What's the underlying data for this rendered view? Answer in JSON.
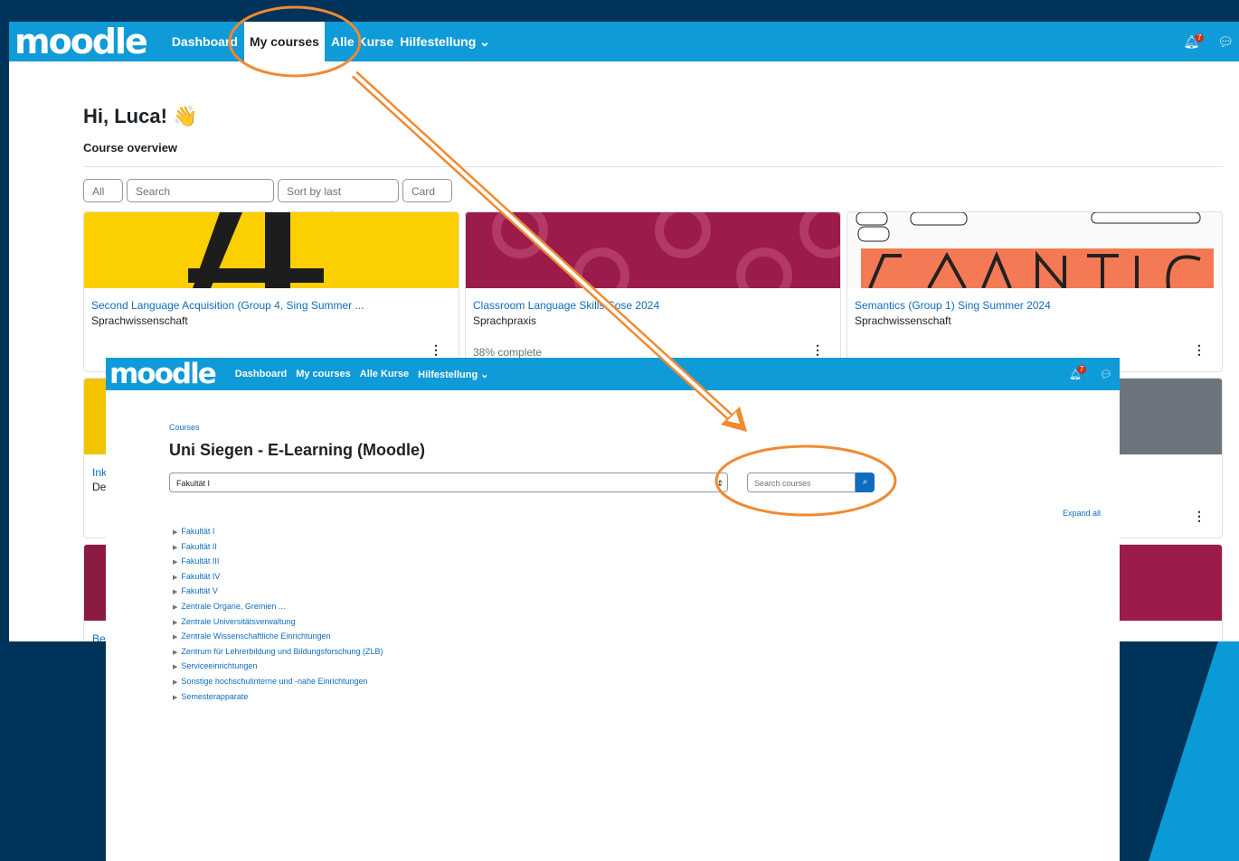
{
  "colors": {
    "background": "#003359",
    "navbar": "#0f9ad8",
    "annotation": "#f08a30",
    "link": "#0f6cbf"
  },
  "top": {
    "nav": {
      "logo": "moodle",
      "links": [
        "Dashboard",
        "My courses",
        "Alle Kurse",
        "Hilfestellung ⌄"
      ],
      "active": "My courses",
      "notification_count": "7"
    },
    "greeting": "Hi, Luca! 👋",
    "section_title": "Course overview",
    "controls": {
      "filter": "All ⌄",
      "search_placeholder": "Search",
      "sort": "Sort by last accessed ⌄",
      "view": "Card ⌄"
    },
    "cards": [
      {
        "title": "Second Language Acquisition (Group 4, Sing Summer ...",
        "category": "Sprachwissenschaft",
        "progress": ""
      },
      {
        "title": "Classroom Language Skills Sose 2024",
        "category": "Sprachpraxis",
        "progress": "38% complete"
      },
      {
        "title": "Semantics (Group 1) Sing Summer 2024",
        "category": "Sprachwissenschaft",
        "progress": ""
      }
    ],
    "partial_text": {
      "a": "Ink",
      "b": "De",
      "c": "Be"
    },
    "card_menu_icon": "⋮"
  },
  "bottom": {
    "nav": {
      "logo": "moodle",
      "links": [
        "Dashboard",
        "My courses",
        "Alle Kurse",
        "Hilfestellung ⌄"
      ],
      "notification_count": "7"
    },
    "breadcrumb": "Courses",
    "title": "Uni Siegen - E-Learning (Moodle)",
    "category_select": "Fakultät I",
    "search_placeholder": "Search courses",
    "expand_all": "Expand all",
    "categories": [
      "Fakultät I",
      "Fakultät II",
      "Fakultät III",
      "Fakultät IV",
      "Fakultät V",
      "Zentrale Organe, Gremien ...",
      "Zentrale Universitätsverwaltung",
      "Zentrale Wissenschaftliche Einrichtungen",
      "Zentrum für Lehrerbildung und Bildungsforschung (ZLB)",
      "Serviceeinrichtungen",
      "Sonstige hochschulinterne und -nahe Einrichtungen",
      "Semesterapparate"
    ]
  }
}
